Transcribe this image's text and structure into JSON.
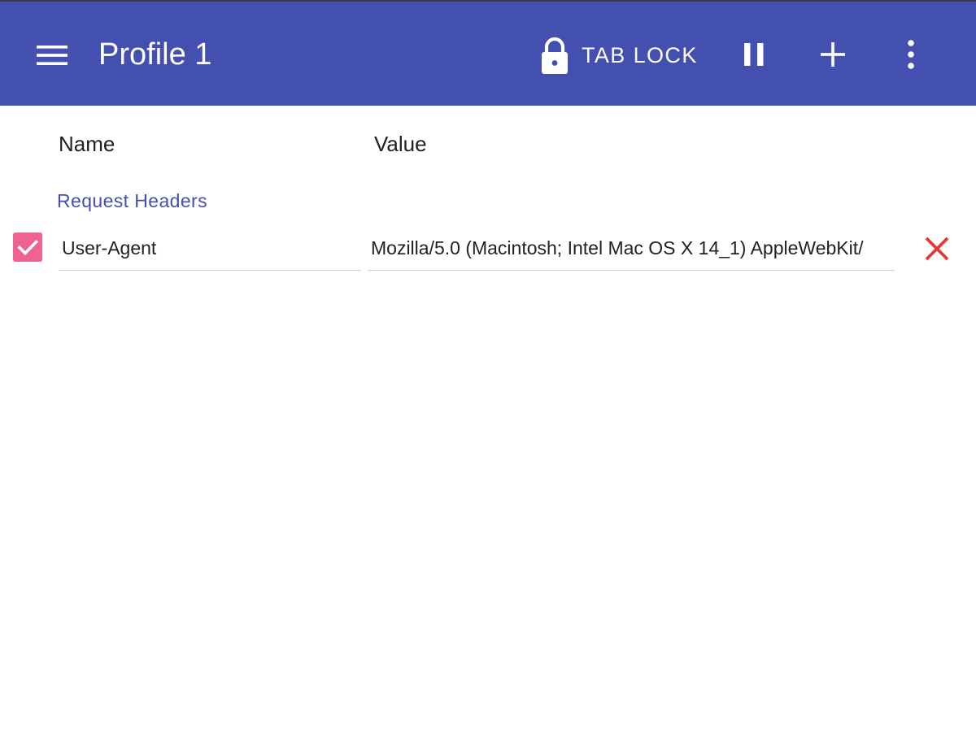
{
  "app_bar": {
    "title": "Profile 1",
    "tab_lock_label": "TAB LOCK",
    "icons": {
      "menu": "menu-icon",
      "lock": "lock-icon",
      "pause": "pause-icon",
      "add": "add-icon",
      "more": "more-vert-icon"
    }
  },
  "columns": {
    "name": "Name",
    "value": "Value"
  },
  "section": {
    "title": "Request Headers"
  },
  "headers": [
    {
      "enabled": true,
      "name": "User-Agent",
      "value": "Mozilla/5.0 (Macintosh; Intel Mac OS X 14_1) AppleWebKit/"
    }
  ],
  "colors": {
    "app_bar": "#4350af",
    "accent": "#4350af",
    "checkbox": "#f06292",
    "delete": "#e53935"
  }
}
